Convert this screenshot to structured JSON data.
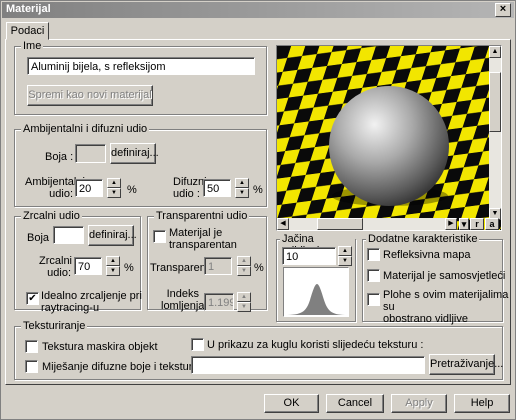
{
  "window": {
    "title": "Materijal",
    "close": "×"
  },
  "tabs": [
    {
      "label": "Podaci"
    }
  ],
  "ime": {
    "legend": "Ime",
    "value": "Aluminij bijela, s refleksijom",
    "save_button": "Spremi kao novi materijal"
  },
  "ambient": {
    "legend": "Ambijentalni i difuzni udio",
    "boja_label": "Boja :",
    "definiraj": "definiraj...",
    "ambient_label_1": "Ambijentalni",
    "ambient_label_2": "udio:",
    "ambient_value": "20",
    "diffuse_label_1": "Difuzni",
    "diffuse_label_2": "udio :",
    "diffuse_value": "50",
    "percent": "%"
  },
  "mirror": {
    "legend": "Zrcalni udio",
    "boja_label": "Boja :",
    "definiraj": "definiraj...",
    "udio_label_1": "Zrcalni",
    "udio_label_2": "udio:",
    "udio_value": "70",
    "percent": "%",
    "ideal_label_1": "Idealno zrcaljenje pri",
    "ideal_label_2": "raytracing-u",
    "ideal_checked": true
  },
  "transparent": {
    "legend": "Transparentni udio",
    "is_transparent_1": "Materijal je",
    "is_transparent_2": "transparentan",
    "transparent_label": "Transparent:",
    "transparent_value": "1",
    "percent": "%",
    "index_label_1": "Indeks",
    "index_label_2": "lomljenja:",
    "index_value": "1.199"
  },
  "preview": {
    "btn_r": "r",
    "btn_a": "a"
  },
  "highlight": {
    "legend": "Jačina odbljeska",
    "value": "10"
  },
  "extra": {
    "legend": "Dodatne karakteristike",
    "reflect_map": "Refleksivna mapa",
    "self_lit": "Materijal je samosvjetleći",
    "both_sides_1": "Plohe s ovim materijalima su",
    "both_sides_2": "obostrano vidljive"
  },
  "texturing": {
    "legend": "Teksturiranje",
    "mask": "Tekstura maskira objekt",
    "mix": "Miješanje difuzne boje i teksture",
    "use_ball": "U prikazu za kuglu koristi slijedeću teksturu :",
    "path_value": "",
    "browse": "Pretraživanje..."
  },
  "footer": {
    "ok": "OK",
    "cancel": "Cancel",
    "apply": "Apply",
    "help": "Help"
  },
  "colors": {
    "checker_yellow": "#f2e600",
    "checker_black": "#0a0a0a",
    "titlebar": "#808080"
  }
}
